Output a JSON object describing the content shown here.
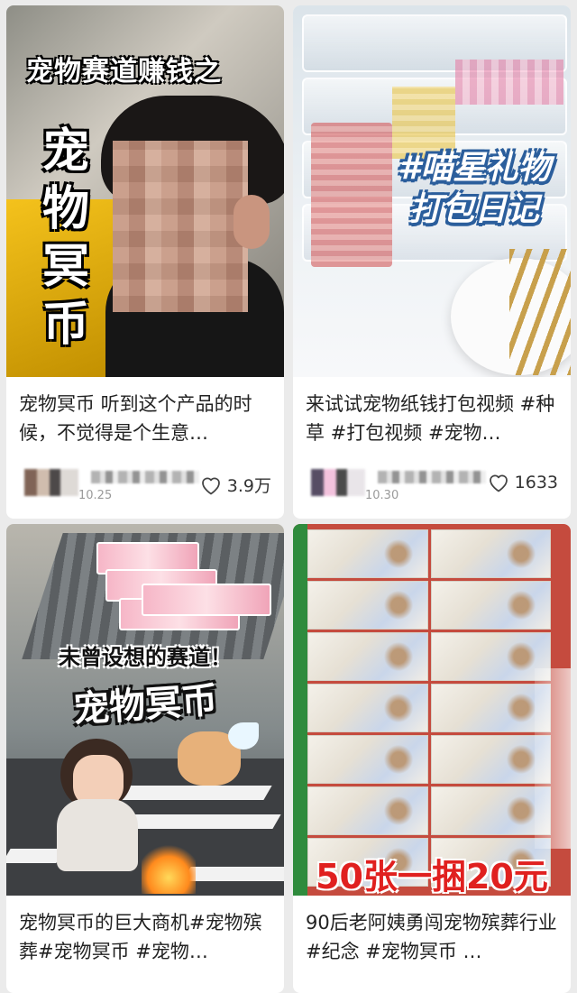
{
  "cards": [
    {
      "thumb_text": [
        "宠物赛道赚钱之",
        "宠物冥币"
      ],
      "caption": "宠物冥币 听到这个产品的时候，不觉得是个生意…",
      "date": "10.25",
      "likes": "3.9万"
    },
    {
      "thumb_text": [
        "#喵星礼物",
        "打包日记"
      ],
      "caption": "来试试宠物纸钱打包视频 #种草 #打包视频 #宠物…",
      "date": "10.30",
      "likes": "1633"
    },
    {
      "thumb_text": [
        "未曾设想的赛道！",
        "宠物冥币"
      ],
      "caption": "宠物冥币的巨大商机#宠物殡葬#宠物冥币 #宠物…"
    },
    {
      "thumb_text": [
        "50张一捆20元"
      ],
      "caption": "90后老阿姨勇闯宠物殡葬行业#纪念 #宠物冥币 …"
    }
  ],
  "icons": {
    "like": "heart-outline-icon"
  },
  "colors": {
    "background": "#ebebeb",
    "card": "#ffffff",
    "price_red": "#e0201f"
  }
}
